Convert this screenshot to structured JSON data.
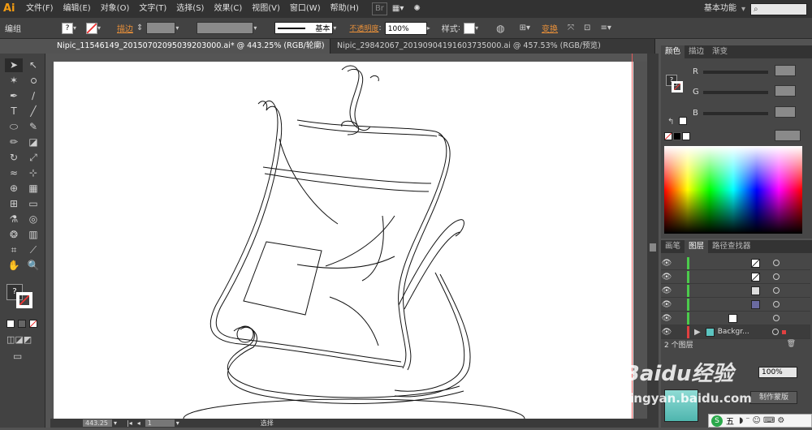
{
  "app": {
    "logo": "Ai"
  },
  "menu": [
    "文件(F)",
    "编辑(E)",
    "对象(O)",
    "文字(T)",
    "选择(S)",
    "效果(C)",
    "视图(V)",
    "窗口(W)",
    "帮助(H)"
  ],
  "menu_right": {
    "workspace": "基本功能",
    "search_placeholder": ""
  },
  "control": {
    "group_label": "编组",
    "stroke_label": "描边",
    "stroke_style": "基本",
    "opacity_label": "不透明度",
    "opacity_value": "100%",
    "style_label": "样式",
    "transform_label": "变换"
  },
  "tabs": [
    {
      "label": "Nipic_11546149_20150702095039203000.ai* @ 443.25% (RGB/轮廓)",
      "close": "×"
    },
    {
      "label": "Nipic_29842067_20190904191603735000.ai @ 457.53% (RGB/预览)",
      "close": ""
    }
  ],
  "color_panel": {
    "tabs": [
      "颜色",
      "描边",
      "渐变"
    ],
    "channels": [
      "R",
      "G",
      "B"
    ]
  },
  "layers_panel": {
    "tabs": [
      "画笔",
      "图层",
      "路径查找器"
    ],
    "bottom_layer_name": "Backgr...",
    "count_label": "2 个图层"
  },
  "appearance": {
    "mask_button": "制作蒙版"
  },
  "status": {
    "zoom": "443.25",
    "page": "1",
    "tool": "选择"
  },
  "watermark": {
    "brand": "Baidu经验",
    "url": "jingyan.baidu.com"
  },
  "ime": {
    "label": "五"
  },
  "colors": {
    "accent": "#e8903a",
    "guide": "#e35a5a"
  }
}
